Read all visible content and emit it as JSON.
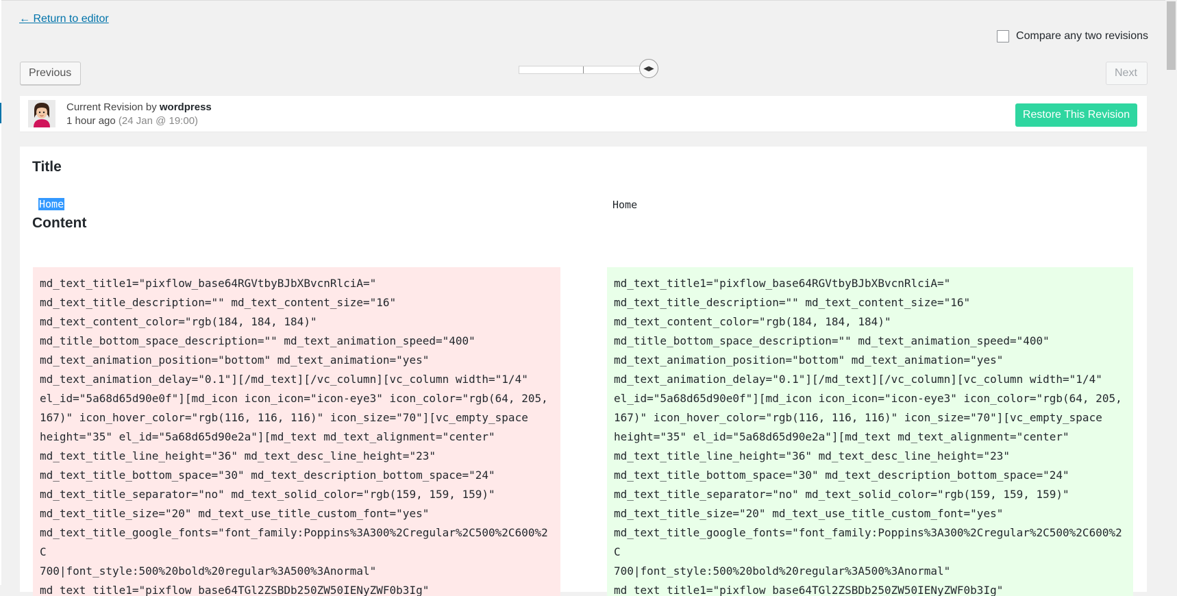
{
  "nav": {
    "return_label": "← Return to editor",
    "compare_label": "Compare any two revisions",
    "previous_label": "Previous",
    "next_label": "Next"
  },
  "slider": {
    "handle_glyph": "◀▶",
    "position_fraction": 1.0
  },
  "revision": {
    "prefix": "Current Revision by ",
    "author": "wordpress",
    "time_ago": "1 hour ago",
    "date": "(24 Jan @ 19:00)",
    "restore_label": "Restore This Revision"
  },
  "diff": {
    "title_heading": "Title",
    "title_left": "Home",
    "title_right": "Home",
    "content_heading": "Content",
    "content_left": "md_text_title1=\"pixflow_base64RGVtbyBJbXBvcnRlciA=\"\nmd_text_title_description=\"\" md_text_content_size=\"16\"\nmd_text_content_color=\"rgb(184, 184, 184)\"\nmd_title_bottom_space_description=\"\" md_text_animation_speed=\"400\"\nmd_text_animation_position=\"bottom\" md_text_animation=\"yes\"\nmd_text_animation_delay=\"0.1\"][/md_text][/vc_column][vc_column width=\"1/4\"\nel_id=\"5a68d65d90e0f\"][md_icon icon_icon=\"icon-eye3\" icon_color=\"rgb(64, 205,\n167)\" icon_hover_color=\"rgb(116, 116, 116)\" icon_size=\"70\"][vc_empty_space\nheight=\"35\" el_id=\"5a68d65d90e2a\"][md_text md_text_alignment=\"center\"\nmd_text_title_line_height=\"36\" md_text_desc_line_height=\"23\"\nmd_text_title_bottom_space=\"30\" md_text_description_bottom_space=\"24\"\nmd_text_title_separator=\"no\" md_text_solid_color=\"rgb(159, 159, 159)\"\nmd_text_title_size=\"20\" md_text_use_title_custom_font=\"yes\"\nmd_text_title_google_fonts=\"font_family:Poppins%3A300%2Cregular%2C500%2C600%2C\n700|font_style:500%20bold%20regular%3A500%3Anormal\"\nmd_text_title1=\"pixflow_base64TGl2ZSBDb250ZW50IENyZWF0b3Ig\"",
    "content_right": "md_text_title1=\"pixflow_base64RGVtbyBJbXBvcnRlciA=\"\nmd_text_title_description=\"\" md_text_content_size=\"16\"\nmd_text_content_color=\"rgb(184, 184, 184)\"\nmd_title_bottom_space_description=\"\" md_text_animation_speed=\"400\"\nmd_text_animation_position=\"bottom\" md_text_animation=\"yes\"\nmd_text_animation_delay=\"0.1\"][/md_text][/vc_column][vc_column width=\"1/4\"\nel_id=\"5a68d65d90e0f\"][md_icon icon_icon=\"icon-eye3\" icon_color=\"rgb(64, 205,\n167)\" icon_hover_color=\"rgb(116, 116, 116)\" icon_size=\"70\"][vc_empty_space\nheight=\"35\" el_id=\"5a68d65d90e2a\"][md_text md_text_alignment=\"center\"\nmd_text_title_line_height=\"36\" md_text_desc_line_height=\"23\"\nmd_text_title_bottom_space=\"30\" md_text_description_bottom_space=\"24\"\nmd_text_title_separator=\"no\" md_text_solid_color=\"rgb(159, 159, 159)\"\nmd_text_title_size=\"20\" md_text_use_title_custom_font=\"yes\"\nmd_text_title_google_fonts=\"font_family:Poppins%3A300%2Cregular%2C500%2C600%2C\n700|font_style:500%20bold%20regular%3A500%3Anormal\"\nmd_text_title1=\"pixflow_base64TGl2ZSBDb250ZW50IENyZWF0b3Ig\""
  },
  "colors": {
    "link": "#0073aa",
    "restore_button": "#2fd6a0",
    "removed_bg": "#ffe9e9",
    "added_bg": "#e9ffe9",
    "selection": "#3399ff"
  }
}
